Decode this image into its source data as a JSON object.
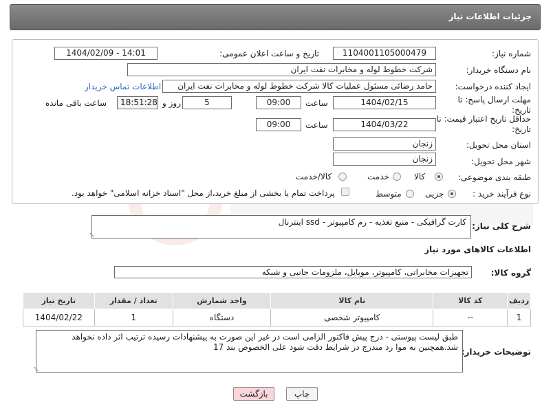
{
  "page": {
    "title": "جزئیات اطلاعات نیاز"
  },
  "form": {
    "need_number_label": "شماره نیاز:",
    "need_number": "1104001105000479",
    "announce_label": "تاریخ و ساعت اعلان عمومی:",
    "announce_value": "1404/02/09 - 14:01",
    "buyer_org_label": "نام دستگاه خریدار:",
    "buyer_org": "شرکت خطوط لوله و مخابرات نفت ایران",
    "requester_label": "ایجاد کننده درخواست:",
    "requester": "حامد  رضائی  مسئول عملیات کالا  شرکت خطوط لوله و مخابرات نفت ایران",
    "contact_link": "اطلاعات تماس خریدار",
    "deadline_label": "مهلت ارسال پاسخ: تا تاریخ:",
    "deadline_date": "1404/02/15",
    "time_label": "ساعت",
    "deadline_time": "09:00",
    "days_value": "5",
    "days_label": "روز و",
    "remaining_time": "18:51:28",
    "remaining_label": "ساعت باقی مانده",
    "validity_label": "حداقل تاریخ اعتبار قیمت: تا تاریخ:",
    "validity_date": "1404/03/22",
    "validity_time": "09:00",
    "province_label": "استان محل تحویل:",
    "province": "زنجان",
    "city_label": "شهر محل تحویل:",
    "city": "زنجان",
    "category_label": "طبقه بندی موضوعی:",
    "category_options": [
      "کالا",
      "خدمت",
      "کالا/خدمت"
    ],
    "process_label": "نوع فرآیند خرید :",
    "process_options": [
      "جزیی",
      "متوسط"
    ],
    "payment_note": "پرداخت تمام یا بخشی از مبلغ خرید،از محل \"اسناد خزانه اسلامی\" خواهد بود."
  },
  "description": {
    "label": "شرح کلی نیاز:",
    "text": "کارت گرافیکی - منبع تغذیه - رم کامپیوتر - ssd اینترنال"
  },
  "goods": {
    "section_title": "اطلاعات کالاهای مورد نیاز",
    "group_label": "گروه کالا:",
    "group_value": "تجهیزات مخابراتی، کامپیوتر، موبایل، ملزومات جانبی و شبکه",
    "columns": [
      "ردیف",
      "کد کالا",
      "نام کالا",
      "واحد شمارش",
      "تعداد / مقدار",
      "تاریخ نیاز"
    ],
    "rows": [
      [
        "1",
        "--",
        "کامپیوتر شخصی",
        "دستگاه",
        "1",
        "1404/02/22"
      ]
    ]
  },
  "buyer_notes": {
    "label": "توضیحات خریدار:",
    "text": "طبق لیست پیوستی - درج پیش فاکتور الزامی است در غیر این صورت به پیشنهادات رسیده ترتیب اثر داده نخواهد شد.همچنین به موا رد مندرج در شرایط دقت شود علی الخصوص بند 17"
  },
  "buttons": {
    "print": "چاپ",
    "back": "بازگشت"
  },
  "colors": {
    "titlebar": "#7a7a7a",
    "link": "#2a6cc4",
    "table_header": "#e1e1e1",
    "back_button": "#f8d7da"
  }
}
